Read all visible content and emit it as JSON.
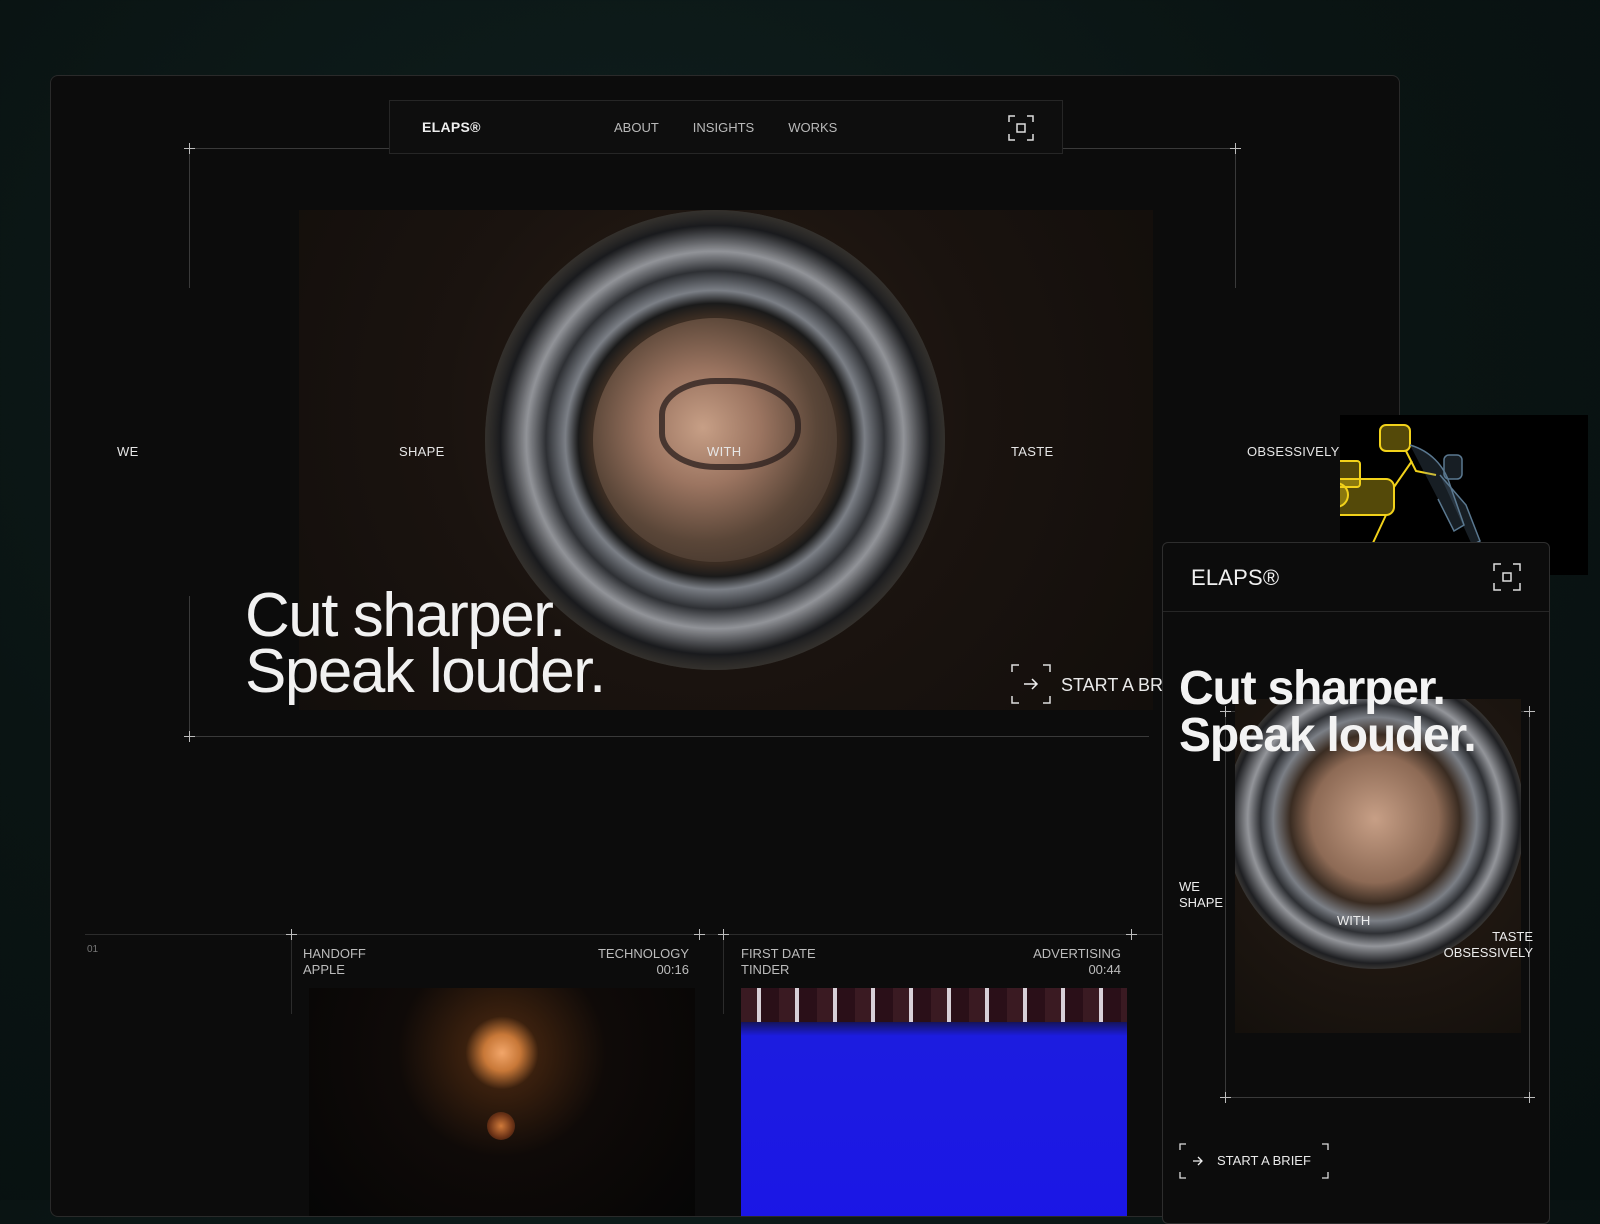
{
  "desktop": {
    "nav": {
      "logo": "ELAPS®",
      "links": [
        "ABOUT",
        "INSIGHTS",
        "WORKS"
      ]
    },
    "hero": {
      "words": [
        "WE",
        "SHAPE",
        "WITH",
        "TASTE",
        "OBSESSIVELY"
      ],
      "title_line1": "Cut sharper.",
      "title_line2": "Speak louder.",
      "cta": "START A BRIEF"
    },
    "works": {
      "index": "01",
      "items": [
        {
          "title": "HANDOFF",
          "client": "APPLE",
          "category": "TECHNOLOGY",
          "duration": "00:16"
        },
        {
          "title": "FIRST DATE",
          "client": "TINDER",
          "category": "ADVERTISING",
          "duration": "00:44"
        }
      ]
    }
  },
  "mobile": {
    "logo": "ELAPS®",
    "title_line1": "Cut sharper.",
    "title_line2": "Speak louder.",
    "words": {
      "we": "WE",
      "shape": "SHAPE",
      "with": "WITH",
      "taste": "TASTE",
      "obsessively": "OBSESSIVELY"
    },
    "cta": "START A BRIEF"
  },
  "colors": {
    "background": "#0c0c0c",
    "text": "#f1f1f1",
    "muted": "#bcbcbc",
    "line": "#3a3a3a",
    "sticker": "#f2d21a"
  },
  "icons": [
    "focus-frame-icon",
    "arrow-right-icon",
    "robot-camera-sticker"
  ]
}
